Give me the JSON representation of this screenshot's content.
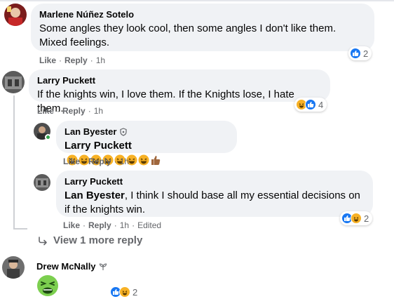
{
  "comments": [
    {
      "author": "Marlene Núñez Sotelo",
      "text": "Some angles they look cool, then some angles I don't like them. Mixed feelings.",
      "like": "Like",
      "reply": "Reply",
      "time": "1h",
      "reaction_count": "2"
    },
    {
      "author": "Larry Puckett",
      "text": "If the knights win, I love them. If the Knights lose, I hate them.",
      "like": "Like",
      "reply": "Reply",
      "time": "1h",
      "reaction_count": "4"
    },
    {
      "author": "Lan Byester",
      "mention": "Larry Puckett",
      "like": "Like",
      "reply": "Reply",
      "time": "1h"
    },
    {
      "author": "Larry Puckett",
      "mention": "Lan Byester",
      "text": ", I think I should base all my essential decisions on if the knights win.",
      "like": "Like",
      "reply": "Reply",
      "time": "1h",
      "edited": "Edited",
      "reaction_count": "2"
    },
    {
      "author": "Drew McNally",
      "reaction_count": "2"
    }
  ],
  "view_more": "View 1 more reply",
  "colors": {
    "like_blue": "#1877f2",
    "haha_yellow": "#f7b125",
    "muted": "#65676b",
    "bubble": "#f0f2f5"
  },
  "icons": [
    "like-icon",
    "haha-icon",
    "nauseated-face-icon",
    "reply-arrow-icon",
    "shield-badge-icon",
    "sprout-badge-icon",
    "thumbs-up-emoji-icon"
  ]
}
